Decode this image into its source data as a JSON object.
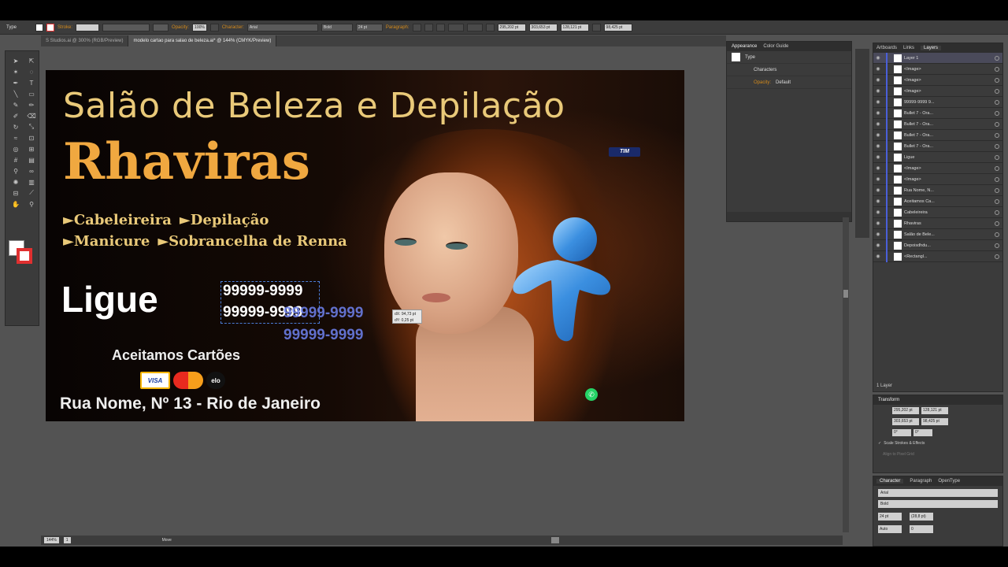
{
  "topbar": {
    "tool_label": "Type",
    "stroke_label": "Stroke:",
    "opacity_label": "Opacity:",
    "opacity_value": "100%",
    "character_label": "Character:",
    "font": "Arial",
    "style": "Bold",
    "size": "24 pt",
    "paragraph_label": "Paragraph:",
    "x_value": "295,202 pt",
    "y_value": "303,653 pt",
    "w_value": "128,121 pt",
    "h_value": "98,425 pt"
  },
  "tabs": [
    {
      "label": "S Studios.ai @ 300% (RGB/Preview)"
    },
    {
      "label": "modelo cartao para salao de beleza.ai* @ 144% (CMYK/Preview)"
    }
  ],
  "card": {
    "title": "Salão de Beleza e Depilação",
    "brand": "Rhaviras",
    "service_row1": [
      "►Cabeleireira",
      "►Depilação"
    ],
    "service_row2": [
      "►Manicure",
      "►Sobrancelha de Renna"
    ],
    "ligue": "Ligue",
    "phone1": "99999-9999",
    "phone2": "99999-9999",
    "ghost1": "99999-9999",
    "ghost2": "99999-9999",
    "measure_dx": "dX: 94,73 pt",
    "measure_dy": "dY: 0,25 pt",
    "cards_label": "Aceitamos Cartões",
    "card_visa": "VISA",
    "card_mc": "MasterCard",
    "card_elo": "elo",
    "address": "Rua Nome, Nº 13 - Rio de Janeiro",
    "tim": "TIM"
  },
  "appearance": {
    "tab1": "Appearance",
    "tab2": "Color Guide",
    "row_type": "Type",
    "row_characters": "Characters",
    "row_opacity_label": "Opacity:",
    "row_opacity_value": "Default"
  },
  "layers": {
    "tab1": "Artboards",
    "tab2": "Links",
    "tab3": "Layers",
    "items": [
      "Layer 1",
      "<Image>",
      "<Image>",
      "<Image>",
      "99999-9999 9...",
      "Bullet 7 - Ora...",
      "Bullet 7 - Ora...",
      "Bullet 7 - Ora...",
      "Bullet 7 - Ora...",
      "Ligue",
      "<Image>",
      "<Image>",
      "Rua Nome, N...",
      "Aceitamos Ca...",
      "Cabeleireira",
      "Rhaviras",
      "Salão de Bele...",
      "Depoisdhdu...",
      "<Rectangl..."
    ],
    "count": "1 Layer"
  },
  "transform": {
    "title": "Transform",
    "x": "295,202 pt",
    "y": "303,653 pt",
    "w": "128,121 pt",
    "h": "98,425 pt",
    "rot": "0°",
    "shear": "0°",
    "scale_strokes": "Scale Strokes & Effects",
    "align_pixel": "Align to Pixel Grid"
  },
  "character": {
    "tab1": "Character",
    "tab2": "Paragraph",
    "tab3": "OpenType",
    "font": "Arial",
    "style": "Bold",
    "size": "24 pt",
    "leading": "(28,8 pt)",
    "kerning": "Auto",
    "tracking": "0"
  },
  "statusbar": {
    "zoom": "144%",
    "page": "1",
    "mode": "Move"
  }
}
